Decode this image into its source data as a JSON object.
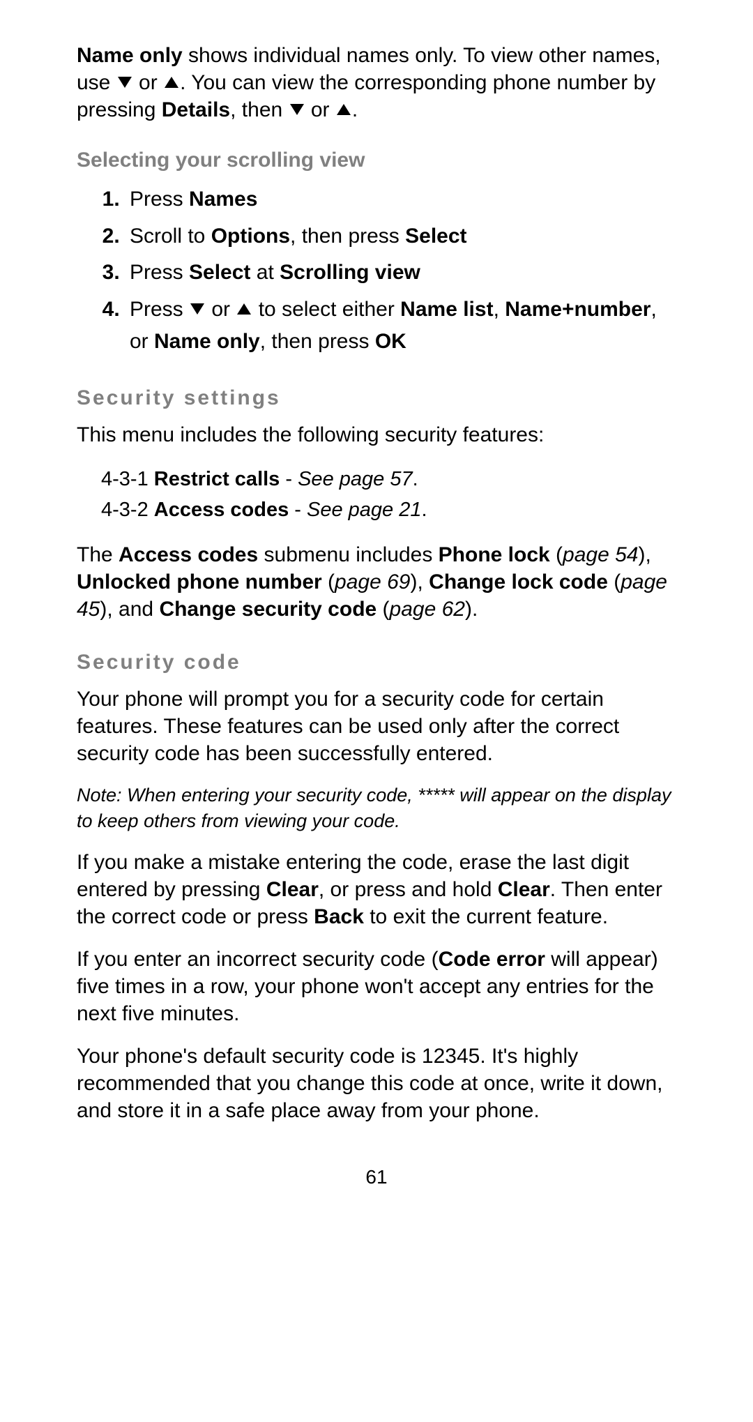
{
  "intro": {
    "bold_nameonly": "Name only",
    "text1": " shows individual names only. To view other names, use ",
    "text2": " or ",
    "text3": ". You can view the corresponding phone number by pressing ",
    "bold_details": "Details",
    "text4": ", then ",
    "text5": " or ",
    "text6": "."
  },
  "heading1": "Selecting your scrolling view",
  "steps": {
    "s1_a": "Press ",
    "s1_b": "Names",
    "s2_a": "Scroll to ",
    "s2_b": "Options",
    "s2_c": ", then press ",
    "s2_d": "Select",
    "s3_a": "Press ",
    "s3_b": "Select",
    "s3_c": " at ",
    "s3_d": "Scrolling view",
    "s4_a": "Press ",
    "s4_b": " or ",
    "s4_c": " to select either ",
    "s4_d": "Name list",
    "s4_e": ", ",
    "s4_f": "Name+number",
    "s4_g": ", or ",
    "s4_h": "Name only",
    "s4_i": ", then press ",
    "s4_j": "OK"
  },
  "heading2": "Security settings",
  "secset_intro": "This menu includes the following security features:",
  "menuitems": {
    "i1_a": "4-3-1 ",
    "i1_b": "Restrict calls",
    "i1_c": " - ",
    "i1_d": "See page 57",
    "i1_e": ".",
    "i2_a": "4-3-2 ",
    "i2_b": "Access codes",
    "i2_c": " - ",
    "i2_d": "See page 21",
    "i2_e": "."
  },
  "access_para": {
    "a": "The ",
    "b": "Access codes",
    "c": " submenu includes ",
    "d": "Phone lock",
    "e": " (",
    "f": "page 54",
    "g": "), ",
    "h": "Unlocked phone number",
    "i": " (",
    "j": "page 69",
    "k": "), ",
    "l": "Change lock code",
    "m": " (",
    "n": "page 45",
    "o": "), and ",
    "p": "Change security code",
    "q": " (",
    "r": "page 62",
    "s": ")."
  },
  "heading3": "Security code",
  "seccode_p1": "Your phone will prompt you for a security code for certain features. These features can be used only after the correct security code has been successfully entered.",
  "note": "Note: When entering your security code, ***** will appear on the display to keep others from viewing your code.",
  "mistake": {
    "a": "If you make a mistake entering the code, erase the last digit entered by pressing ",
    "b": "Clear",
    "c": ", or press and hold ",
    "d": "Clear",
    "e": ". Then enter the correct code or press ",
    "f": "Back",
    "g": " to exit the current feature."
  },
  "codeerror": {
    "a": "If you enter an incorrect security code (",
    "b": "Code error",
    "c": " will appear) five times in a row, your phone won't accept any entries for the next five minutes."
  },
  "default_code": "Your phone's default security code is 12345. It's highly recommended that you change this code at once, write it down, and store it in a safe place away from your phone.",
  "pagenum": "61"
}
